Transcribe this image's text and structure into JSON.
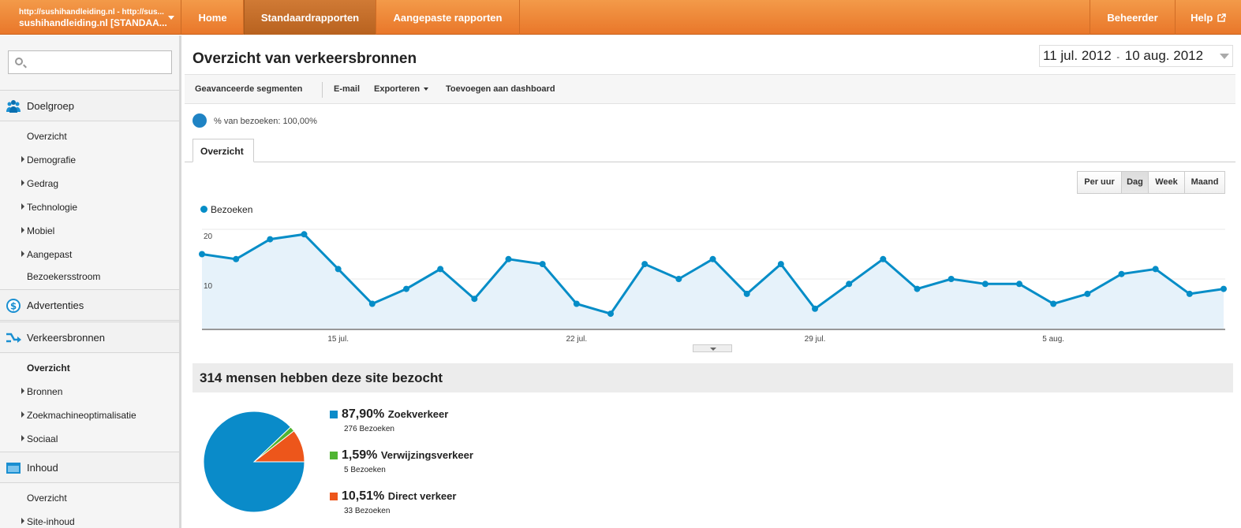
{
  "topbar": {
    "account_url": "http://sushihandleiding.nl - http://sus...",
    "account_name": "sushihandleiding.nl [STANDAA...",
    "tabs": [
      {
        "label": "Home"
      },
      {
        "label": "Standaardrapporten",
        "active": true
      },
      {
        "label": "Aangepaste rapporten"
      }
    ],
    "admin_label": "Beheerder",
    "help_label": "Help"
  },
  "sidebar": {
    "search_placeholder": "",
    "sections": [
      {
        "label": "Doelgroep",
        "icon": "audience-icon",
        "items": [
          "Overzicht",
          "Demografie",
          "Gedrag",
          "Technologie",
          "Mobiel",
          "Aangepast",
          "Bezoekersstroom"
        ]
      },
      {
        "label": "Advertenties",
        "icon": "dollar-icon",
        "items": []
      },
      {
        "label": "Verkeersbronnen",
        "icon": "traffic-arrows-icon",
        "items": [
          "Overzicht",
          "Bronnen",
          "Zoekmachineoptimalisatie",
          "Sociaal"
        ]
      },
      {
        "label": "Inhoud",
        "icon": "content-icon",
        "items": [
          "Overzicht",
          "Site-inhoud"
        ]
      }
    ]
  },
  "main": {
    "title": "Overzicht van verkeersbronnen",
    "date_start": "11 jul. 2012",
    "date_sep": "-",
    "date_end": "10 aug. 2012",
    "toolbar": {
      "segments": "Geavanceerde segmenten",
      "email": "E-mail",
      "export": "Exporteren",
      "dashboard": "Toevoegen aan dashboard"
    },
    "segment_text": "% van bezoeken: 100,00%",
    "tab": "Overzicht",
    "period_buttons": [
      "Per uur",
      "Dag",
      "Week",
      "Maand"
    ],
    "visitors_heading": "314 mensen hebben deze site bezocht"
  },
  "colors": {
    "accent": "#058dc7",
    "search": "#0a8bc9",
    "referral": "#50b432",
    "direct": "#ed561b"
  },
  "chart_data": {
    "type": "area",
    "series": [
      {
        "name": "Bezoeken",
        "values": [
          15,
          14,
          18,
          19,
          12,
          5,
          8,
          12,
          6,
          14,
          13,
          5,
          3,
          13,
          10,
          14,
          7,
          13,
          4,
          9,
          14,
          8,
          10,
          9,
          9,
          5,
          7,
          11,
          12,
          7,
          8
        ]
      }
    ],
    "x": [
      "11 jul.",
      "12 jul.",
      "13 jul.",
      "14 jul.",
      "15 jul.",
      "16 jul.",
      "17 jul.",
      "18 jul.",
      "19 jul.",
      "20 jul.",
      "21 jul.",
      "22 jul.",
      "23 jul.",
      "24 jul.",
      "25 jul.",
      "26 jul.",
      "27 jul.",
      "28 jul.",
      "29 jul.",
      "30 jul.",
      "31 jul.",
      "1 aug.",
      "2 aug.",
      "3 aug.",
      "4 aug.",
      "5 aug.",
      "6 aug.",
      "7 aug.",
      "8 aug.",
      "9 aug.",
      "10 aug."
    ],
    "x_tick_labels": [
      "15 jul.",
      "22 jul.",
      "29 jul.",
      "5 aug."
    ],
    "y_ticks": [
      "20",
      "10"
    ],
    "ylim": [
      0,
      20
    ],
    "grid": true
  },
  "pie_data": {
    "type": "pie",
    "slices": [
      {
        "pct": "87,90%",
        "value": 87.9,
        "name": "Zoekverkeer",
        "count": "276 Bezoeken",
        "color": "#0a8bc9"
      },
      {
        "pct": "1,59%",
        "value": 1.59,
        "name": "Verwijzingsverkeer",
        "count": "5 Bezoeken",
        "color": "#50b432"
      },
      {
        "pct": "10,51%",
        "value": 10.51,
        "name": "Direct verkeer",
        "count": "33 Bezoeken",
        "color": "#ed561b"
      }
    ]
  }
}
